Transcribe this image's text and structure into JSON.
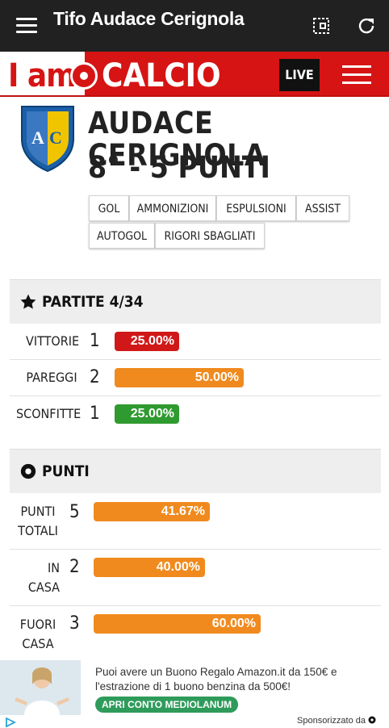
{
  "app": {
    "title": "Tifo Audace Cerignola"
  },
  "brand": {
    "left": "I am",
    "right": "CALCIO",
    "live": "LIVE"
  },
  "team": {
    "name": "AUDACE CERIGNOLA",
    "rank": "8° - 5 PUNTI"
  },
  "filters": [
    "GOL",
    "AMMONIZIONI",
    "ESPULSIONI",
    "ASSIST",
    "AUTOGOL",
    "RIGORI SBAGLIATI"
  ],
  "partite": {
    "title": "PARTITE 4/34",
    "rows": [
      {
        "label": "VITTORIE",
        "value": "1",
        "pct": "25.00%",
        "fraction": 0.25,
        "color": "#d01818"
      },
      {
        "label": "PAREGGI",
        "value": "2",
        "pct": "50.00%",
        "fraction": 0.5,
        "color": "#f08a1e"
      },
      {
        "label": "SCONFITTE",
        "value": "1",
        "pct": "25.00%",
        "fraction": 0.25,
        "color": "#2f9a2f"
      }
    ]
  },
  "punti": {
    "title": "PUNTI",
    "rows": [
      {
        "label1": "PUNTI",
        "label2": "TOTALI",
        "value": "5",
        "pct": "41.67%",
        "fraction": 0.4167,
        "color": "#f08a1e"
      },
      {
        "label1": "IN",
        "label2": "CASA",
        "value": "2",
        "pct": "40.00%",
        "fraction": 0.4,
        "color": "#f08a1e"
      },
      {
        "label1": "FUORI",
        "label2": "CASA",
        "value": "3",
        "pct": "60.00%",
        "fraction": 0.6,
        "color": "#f08a1e"
      }
    ]
  },
  "ad": {
    "text": "Puoi avere un Buono Regalo Amazon.it da 150€ e l'estrazione di 1 buono benzina da 500€!",
    "cta": "APRI CONTO MEDIOLANUM",
    "sponsored": "Sponsorizzato da"
  }
}
